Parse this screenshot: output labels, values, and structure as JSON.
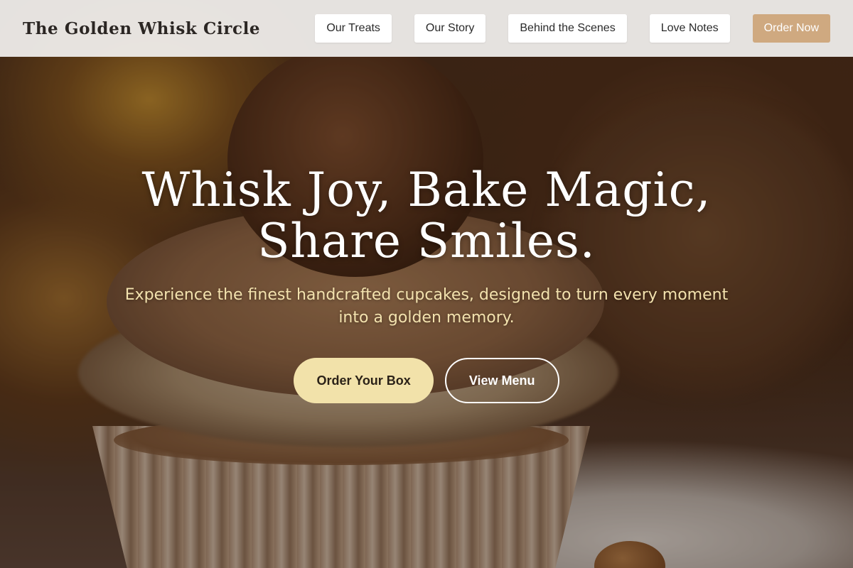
{
  "header": {
    "brand": "The Golden Whisk Circle",
    "nav": {
      "treats": "Our Treats",
      "story": "Our Story",
      "behind": "Behind the Scenes",
      "love": "Love Notes",
      "order": "Order Now"
    }
  },
  "hero": {
    "title_line1": "Whisk Joy, Bake Magic,",
    "title_line2": "Share Smiles.",
    "subtitle": "Experience the finest handcrafted cupcakes, designed to turn every moment into a golden memory.",
    "primary_button": "Order Your Box",
    "secondary_button": "View Menu"
  },
  "colors": {
    "header_bg": "#f0eeec",
    "accent_tan": "#cfa980",
    "cream": "#f2e2aa",
    "subtitle_gold": "#f3e2ae"
  }
}
